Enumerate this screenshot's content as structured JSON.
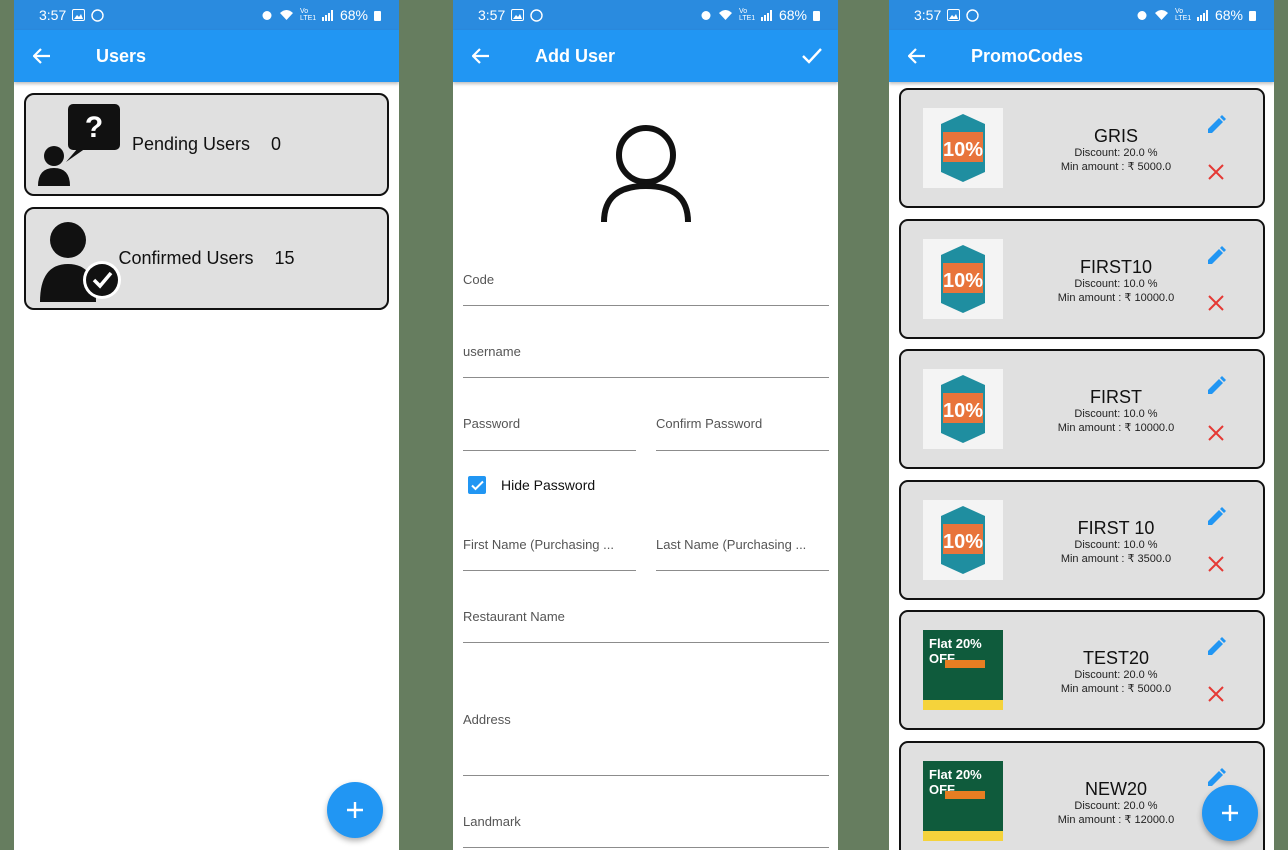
{
  "status": {
    "time": "3:57",
    "battery": "68%",
    "network": "Vo LTE1"
  },
  "users_screen": {
    "title": "Users",
    "cards": [
      {
        "label": "Pending Users",
        "count": "0",
        "icon": "pending-user-icon"
      },
      {
        "label": "Confirmed Users",
        "count": "15",
        "icon": "confirmed-user-icon"
      }
    ]
  },
  "add_user_screen": {
    "title": "Add User",
    "fields": {
      "code": "Code",
      "username": "username",
      "password": "Password",
      "confirm_password": "Confirm Password",
      "first_name": "First Name (Purchasing ...",
      "last_name": "Last Name (Purchasing ...",
      "restaurant": "Restaurant Name",
      "address": "Address",
      "landmark": "Landmark"
    },
    "hide_password": {
      "label": "Hide Password",
      "checked": true
    }
  },
  "promo_screen": {
    "title": "PromoCodes",
    "items": [
      {
        "code": "GRIS",
        "discount": "Discount: 20.0 %",
        "min": "Min amount : ₹ 5000.0",
        "image": "ten-percent-badge"
      },
      {
        "code": "FIRST10",
        "discount": "Discount: 10.0 %",
        "min": "Min amount : ₹ 10000.0",
        "image": "ten-percent-badge"
      },
      {
        "code": "FIRST",
        "discount": "Discount: 10.0 %",
        "min": "Min amount : ₹ 10000.0",
        "image": "ten-percent-badge"
      },
      {
        "code": "FIRST 10",
        "discount": "Discount: 10.0 %",
        "min": "Min amount : ₹ 3500.0",
        "image": "ten-percent-badge"
      },
      {
        "code": "TEST20",
        "discount": "Discount: 20.0 %",
        "min": "Min amount : ₹ 5000.0",
        "image": "flat-20-off-banner"
      },
      {
        "code": "NEW20",
        "discount": "Discount: 20.0 %",
        "min": "Min amount : ₹ 12000.0",
        "image": "flat-20-off-banner"
      }
    ],
    "banner_text": "Flat 20% OFF",
    "badge_text": "10%"
  },
  "colors": {
    "primary": "#2196f3",
    "status": "#2a8bdf",
    "delete": "#e53935",
    "card": "#e0e0e0"
  }
}
